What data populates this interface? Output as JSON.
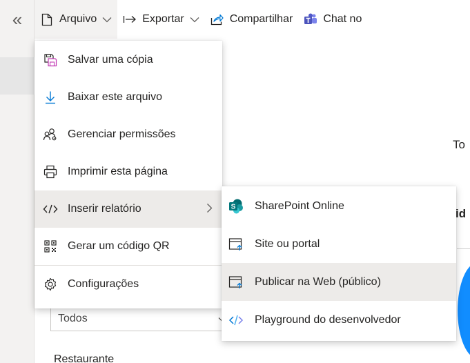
{
  "toolbar": {
    "collapse_label": "«",
    "items": [
      {
        "label": "Arquivo",
        "icon": "document-icon"
      },
      {
        "label": "Exportar",
        "icon": "export-arrow-icon"
      },
      {
        "label": "Compartilhar",
        "icon": "share-icon"
      },
      {
        "label": "Chat no",
        "icon": "teams-icon"
      }
    ]
  },
  "background": {
    "text_to": "To",
    "text_id": "id",
    "slicer_value": "Todos",
    "text_restaurante": "Restaurante"
  },
  "file_menu": {
    "items": [
      {
        "label": "Salvar uma cópia",
        "icon": "save-copy-icon"
      },
      {
        "label": "Baixar este arquivo",
        "icon": "download-icon"
      },
      {
        "label": "Gerenciar permissões",
        "icon": "manage-permissions-icon"
      },
      {
        "label": "Imprimir esta página",
        "icon": "print-icon"
      },
      {
        "label": "Inserir relatório",
        "icon": "code-icon",
        "has_submenu": true
      },
      {
        "label": "Gerar um código QR",
        "icon": "qr-code-icon"
      },
      {
        "label": "Configurações",
        "icon": "settings-icon"
      }
    ]
  },
  "embed_submenu": {
    "items": [
      {
        "label": "SharePoint Online",
        "icon": "sharepoint-icon"
      },
      {
        "label": "Site ou portal",
        "icon": "website-icon"
      },
      {
        "label": "Publicar na Web (público)",
        "icon": "publish-web-icon"
      },
      {
        "label": "Playground do desenvolvedor",
        "icon": "developer-playground-icon"
      }
    ]
  },
  "colors": {
    "accent": "#0078d4",
    "sharepoint": "#038387",
    "teams": "#4b53bc",
    "hover_bg": "#edebe9",
    "rail_bg": "#f3f2f1",
    "donut": "#118dff"
  }
}
